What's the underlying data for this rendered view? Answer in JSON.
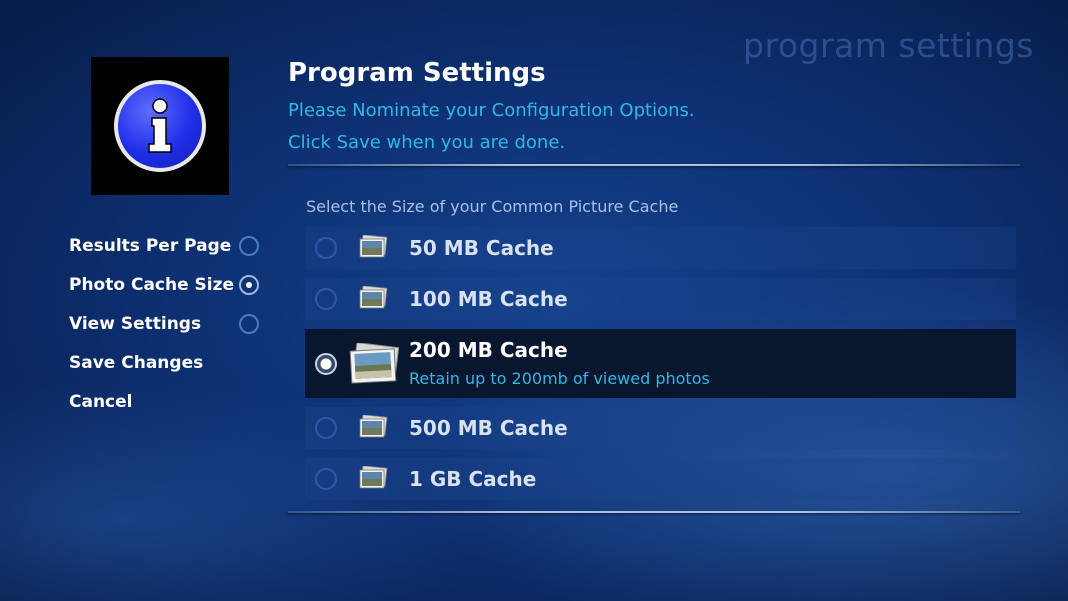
{
  "watermark": "program settings",
  "header": {
    "title": "Program Settings",
    "subtitle_line1": "Please Nominate your Configuration Options.",
    "subtitle_line2": "Click Save when you are done."
  },
  "icons": {
    "logo": "info-icon",
    "option_thumbnail": "photo-stack-icon"
  },
  "sidebar": {
    "items": [
      {
        "label": "Results Per Page",
        "radio": true,
        "selected": false
      },
      {
        "label": "Photo Cache Size",
        "radio": true,
        "selected": true
      },
      {
        "label": "View Settings",
        "radio": true,
        "selected": false
      },
      {
        "label": "Save Changes",
        "radio": false,
        "selected": false
      },
      {
        "label": "Cancel",
        "radio": false,
        "selected": false
      }
    ]
  },
  "cache": {
    "section_label": "Select the Size of your Common Picture Cache",
    "options": [
      {
        "label": "50 MB Cache",
        "selected": false
      },
      {
        "label": "100 MB Cache",
        "selected": false
      },
      {
        "label": "200 MB Cache",
        "selected": true,
        "description": "Retain up to 200mb of viewed photos"
      },
      {
        "label": "500 MB Cache",
        "selected": false
      },
      {
        "label": "1 GB Cache",
        "selected": false
      }
    ]
  },
  "colors": {
    "accent_text": "#2fb8e8",
    "background": "#0d2f70",
    "selected_row": "#08162e",
    "logo_blue": "#1f2ee8"
  }
}
